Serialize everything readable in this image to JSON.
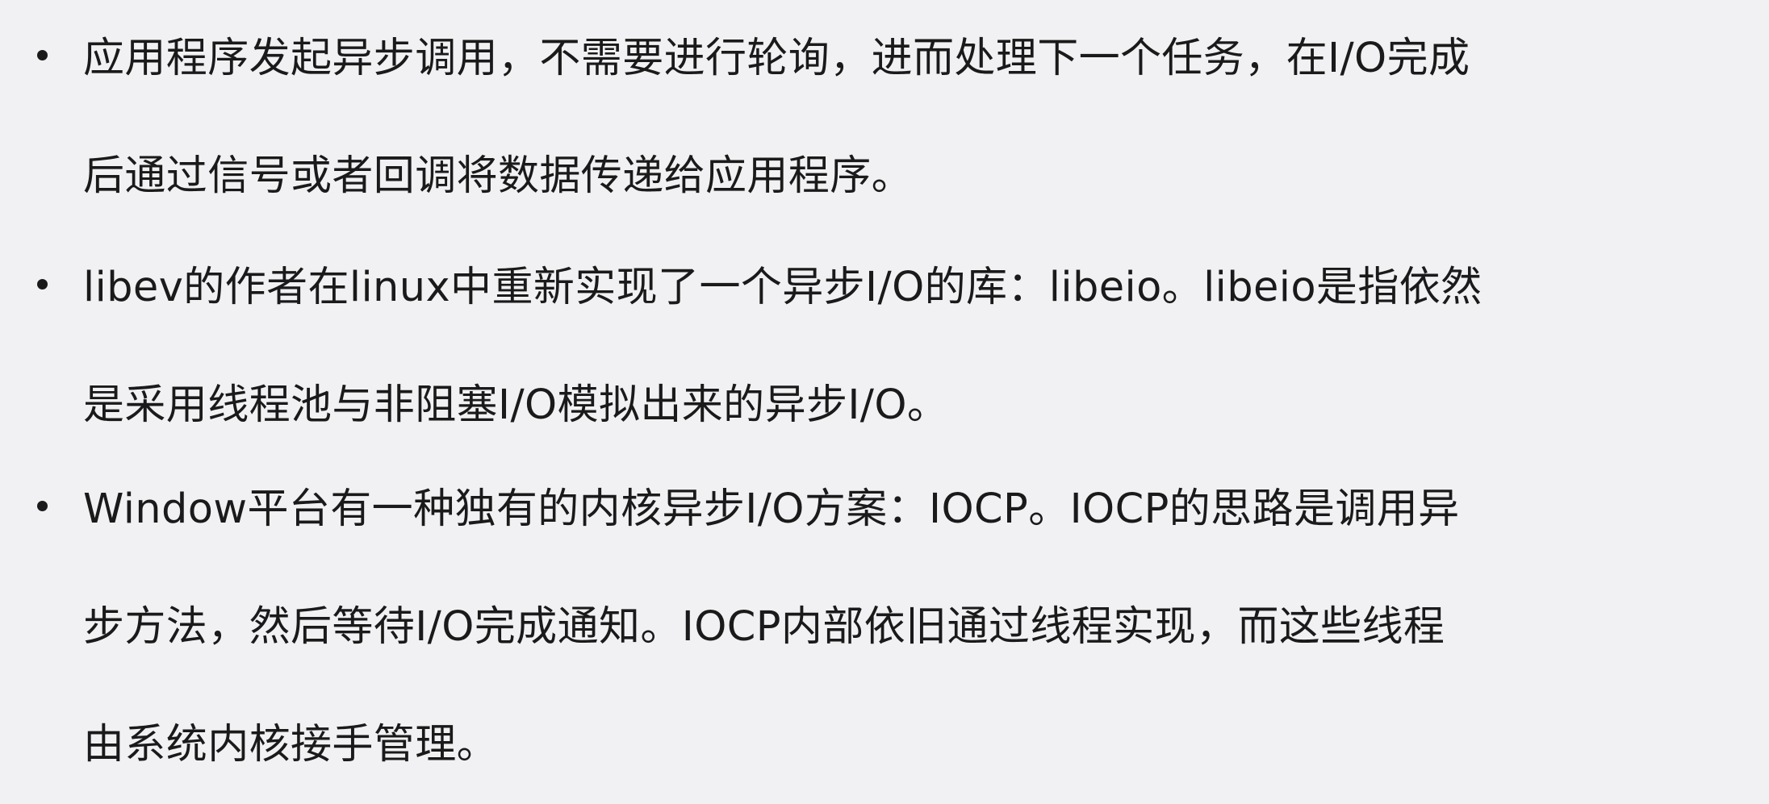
{
  "document": {
    "bullets": [
      {
        "lines": [
          "应用程序发起异步调用，不需要进行轮询，进而处理下一个任务，在I/O完成",
          "后通过信号或者回调将数据传递给应用程序。"
        ]
      },
      {
        "lines": [
          "libev的作者在linux中重新实现了一个异步I/O的库：libeio。libeio是指依然",
          "是采用线程池与非阻塞I/O模拟出来的异步I/O。"
        ]
      },
      {
        "lines": [
          "Window平台有一种独有的内核异步I/O方案：IOCP。IOCP的思路是调用异",
          "步方法，然后等待I/O完成通知。IOCP内部依旧通过线程实现，而这些线程",
          "由系统内核接手管理。"
        ]
      }
    ]
  },
  "colors": {
    "background": "#f1f1f3",
    "text": "#1a1a1a"
  }
}
